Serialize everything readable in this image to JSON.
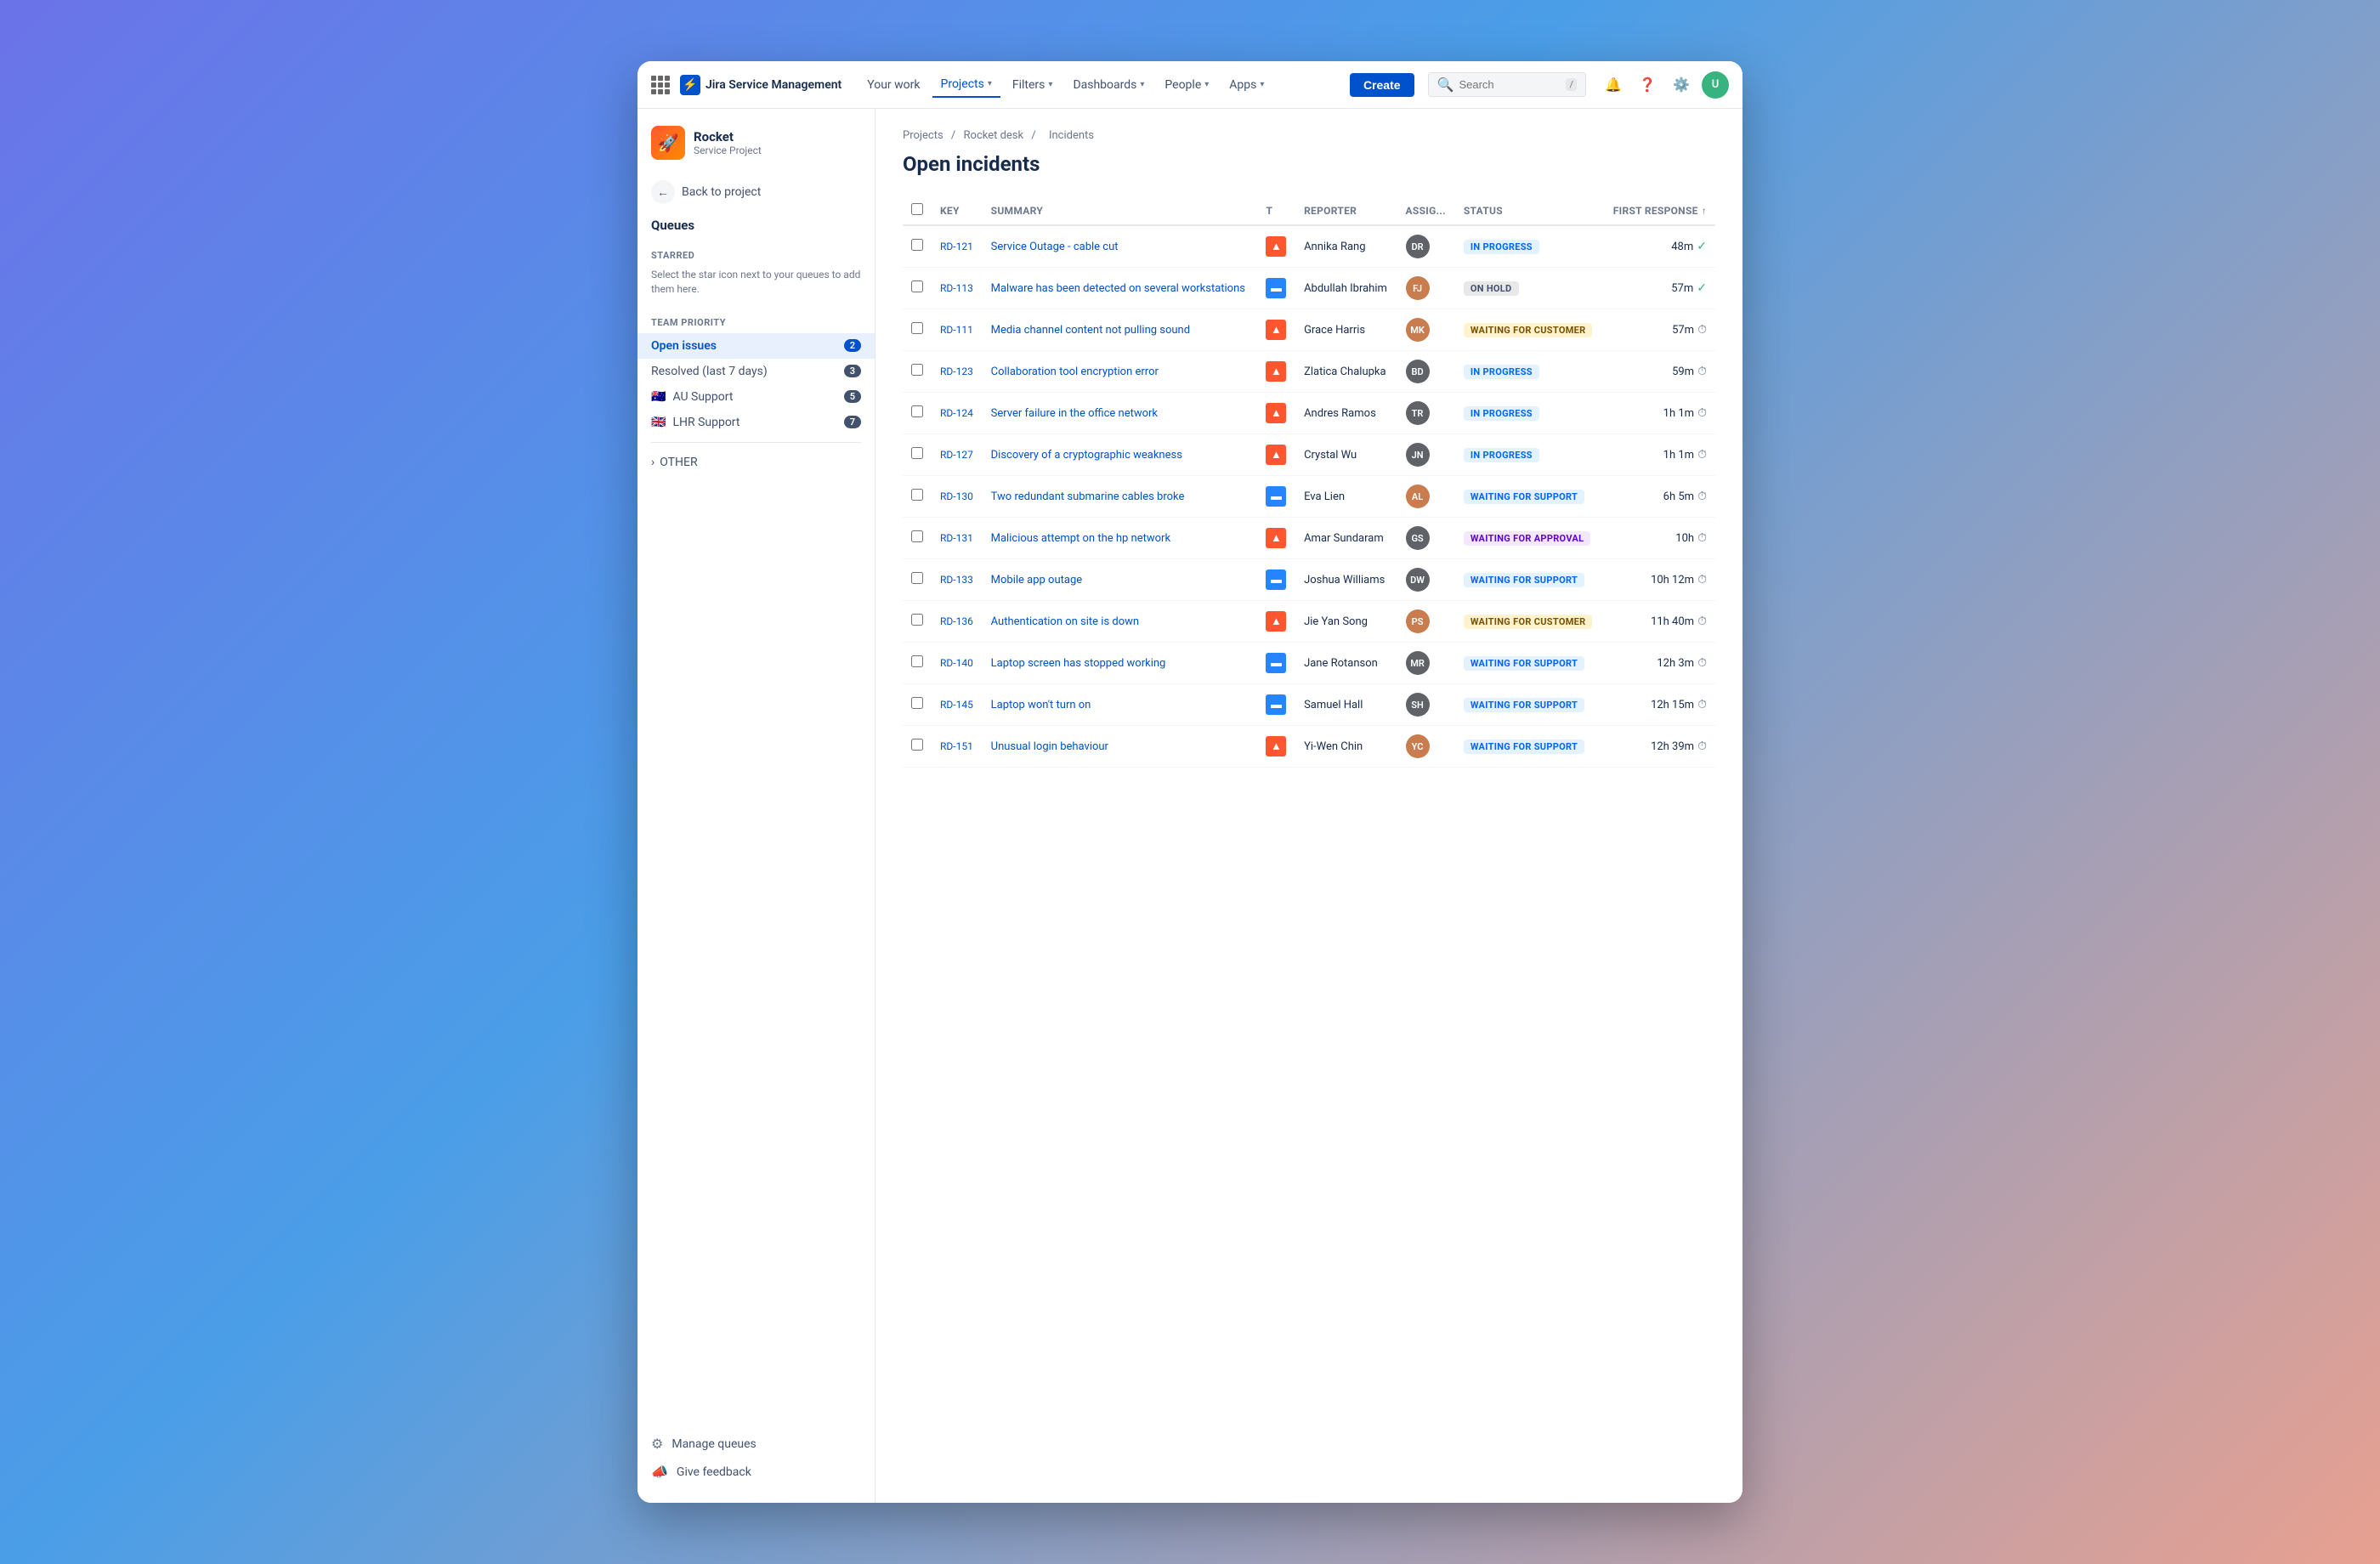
{
  "app": {
    "name": "Jira Service Management"
  },
  "topnav": {
    "your_work": "Your work",
    "projects": "Projects",
    "filters": "Filters",
    "dashboards": "Dashboards",
    "people": "People",
    "apps": "Apps",
    "create": "Create",
    "search_placeholder": "Search",
    "search_shortcut": "/"
  },
  "sidebar": {
    "project_name": "Rocket",
    "project_type": "Service Project",
    "back_label": "Back to project",
    "queues_label": "Queues",
    "starred_label": "STARRED",
    "starred_note": "Select the star icon next to your queues to add them here.",
    "team_priority_label": "TEAM PRIORITY",
    "items": [
      {
        "label": "Open issues",
        "count": 2,
        "active": true,
        "flag": null
      },
      {
        "label": "Resolved (last 7 days)",
        "count": 3,
        "active": false,
        "flag": null
      },
      {
        "label": "AU Support",
        "count": 5,
        "active": false,
        "flag": "🇦🇺"
      },
      {
        "label": "LHR Support",
        "count": 7,
        "active": false,
        "flag": "🇬🇧"
      }
    ],
    "other_label": "OTHER",
    "manage_queues": "Manage queues",
    "give_feedback": "Give feedback"
  },
  "breadcrumb": {
    "parts": [
      "Projects",
      "Rocket desk",
      "Incidents"
    ]
  },
  "page_title": "Open incidents",
  "table": {
    "columns": [
      "Key",
      "Summary",
      "T",
      "Reporter",
      "Assig...",
      "Status",
      "First response"
    ],
    "rows": [
      {
        "key": "RD-121",
        "summary": "Service Outage - cable cut",
        "type": "high",
        "reporter": "Annika Rang",
        "assignee_initials": "DR",
        "assignee_bg": "#5f6368",
        "status": "IN PROGRESS",
        "status_class": "status-in-progress",
        "time": "48m",
        "time_indicator": "check"
      },
      {
        "key": "RD-113",
        "summary": "Malware has been detected on several workstations",
        "type": "medium",
        "reporter": "Abdullah Ibrahim",
        "assignee_initials": "FJ",
        "assignee_bg": "#c97d4e",
        "status": "ON HOLD",
        "status_class": "status-on-hold",
        "time": "57m",
        "time_indicator": "check"
      },
      {
        "key": "RD-111",
        "summary": "Media channel content not pulling sound",
        "type": "high",
        "reporter": "Grace Harris",
        "assignee_initials": "MK",
        "assignee_bg": "#c97d4e",
        "status": "WAITING FOR CUSTOMER",
        "status_class": "status-waiting-customer",
        "time": "57m",
        "time_indicator": "clock"
      },
      {
        "key": "RD-123",
        "summary": "Collaboration tool encryption error",
        "type": "high",
        "reporter": "Zlatica Chalupka",
        "assignee_initials": "BD",
        "assignee_bg": "#5f6368",
        "status": "IN PROGRESS",
        "status_class": "status-in-progress",
        "time": "59m",
        "time_indicator": "clock"
      },
      {
        "key": "RD-124",
        "summary": "Server failure in the office network",
        "type": "high",
        "reporter": "Andres Ramos",
        "assignee_initials": "TR",
        "assignee_bg": "#5f6368",
        "status": "IN PROGRESS",
        "status_class": "status-in-progress",
        "time": "1h 1m",
        "time_indicator": "clock"
      },
      {
        "key": "RD-127",
        "summary": "Discovery of a cryptographic weakness",
        "type": "high",
        "reporter": "Crystal Wu",
        "assignee_initials": "JN",
        "assignee_bg": "#5f6368",
        "status": "IN PROGRESS",
        "status_class": "status-in-progress",
        "time": "1h 1m",
        "time_indicator": "clock"
      },
      {
        "key": "RD-130",
        "summary": "Two redundant submarine cables broke",
        "type": "medium",
        "reporter": "Eva Lien",
        "assignee_initials": "AL",
        "assignee_bg": "#c97d4e",
        "status": "WAITING FOR SUPPORT",
        "status_class": "status-waiting-support",
        "time": "6h 5m",
        "time_indicator": "clock"
      },
      {
        "key": "RD-131",
        "summary": "Malicious attempt on the hp network",
        "type": "high",
        "reporter": "Amar Sundaram",
        "assignee_initials": "GS",
        "assignee_bg": "#5f6368",
        "status": "WAITING FOR APPROVAL",
        "status_class": "status-waiting-approval",
        "time": "10h",
        "time_indicator": "clock"
      },
      {
        "key": "RD-133",
        "summary": "Mobile app outage",
        "type": "medium",
        "reporter": "Joshua Williams",
        "assignee_initials": "DW",
        "assignee_bg": "#5f6368",
        "status": "WAITING FOR SUPPORT",
        "status_class": "status-waiting-support",
        "time": "10h 12m",
        "time_indicator": "clock"
      },
      {
        "key": "RD-136",
        "summary": "Authentication on site is down",
        "type": "high",
        "reporter": "Jie Yan Song",
        "assignee_initials": "PS",
        "assignee_bg": "#c97d4e",
        "status": "WAITING FOR CUSTOMER",
        "status_class": "status-waiting-customer",
        "time": "11h 40m",
        "time_indicator": "clock"
      },
      {
        "key": "RD-140",
        "summary": "Laptop screen has stopped working",
        "type": "medium",
        "reporter": "Jane Rotanson",
        "assignee_initials": "MR",
        "assignee_bg": "#5f6368",
        "status": "WAITING FOR SUPPORT",
        "status_class": "status-waiting-support",
        "time": "12h 3m",
        "time_indicator": "clock"
      },
      {
        "key": "RD-145",
        "summary": "Laptop won't turn on",
        "type": "medium",
        "reporter": "Samuel Hall",
        "assignee_initials": "SH",
        "assignee_bg": "#5f6368",
        "status": "WAITING FOR SUPPORT",
        "status_class": "status-waiting-support",
        "time": "12h 15m",
        "time_indicator": "clock"
      },
      {
        "key": "RD-151",
        "summary": "Unusual login behaviour",
        "type": "high",
        "reporter": "Yi-Wen Chin",
        "assignee_initials": "YC",
        "assignee_bg": "#c97d4e",
        "status": "WAITING FOR SUPPORT",
        "status_class": "status-waiting-support",
        "time": "12h 39m",
        "time_indicator": "clock"
      }
    ]
  }
}
